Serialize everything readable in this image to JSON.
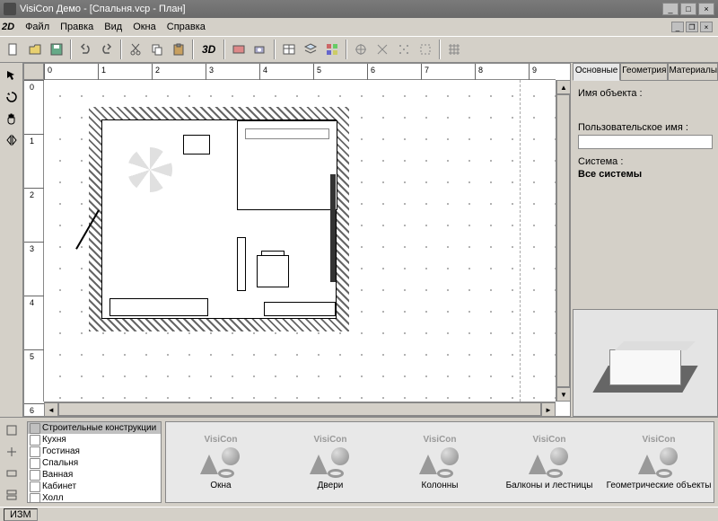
{
  "window": {
    "title": "VisiCon Демо - [Спальня.vcp - План]"
  },
  "menu": {
    "view2d": "2D",
    "items": [
      "Файл",
      "Правка",
      "Вид",
      "Окна",
      "Справка"
    ]
  },
  "toolbar": {
    "label3d": "3D"
  },
  "ruler": {
    "h": [
      "0",
      "1",
      "2",
      "3",
      "4",
      "5",
      "6",
      "7",
      "8",
      "9"
    ],
    "v": [
      "0",
      "1",
      "2",
      "3",
      "4",
      "5",
      "6"
    ]
  },
  "props": {
    "tabs": [
      "Основные",
      "Геометрия",
      "Материалы"
    ],
    "name_label": "Имя объекта :",
    "user_label": "Пользовательское имя :",
    "system_label": "Система :",
    "system_value": "Все системы",
    "user_value": ""
  },
  "categories": [
    "Строительные конструкции",
    "Кухня",
    "Гостиная",
    "Спальня",
    "Ванная",
    "Кабинет",
    "Холл"
  ],
  "library": {
    "brand": "VisiCon",
    "items": [
      "Окна",
      "Двери",
      "Колонны",
      "Балконы и лестницы",
      "Геометрические объекты"
    ]
  },
  "status": {
    "izm": "ИЗМ"
  }
}
